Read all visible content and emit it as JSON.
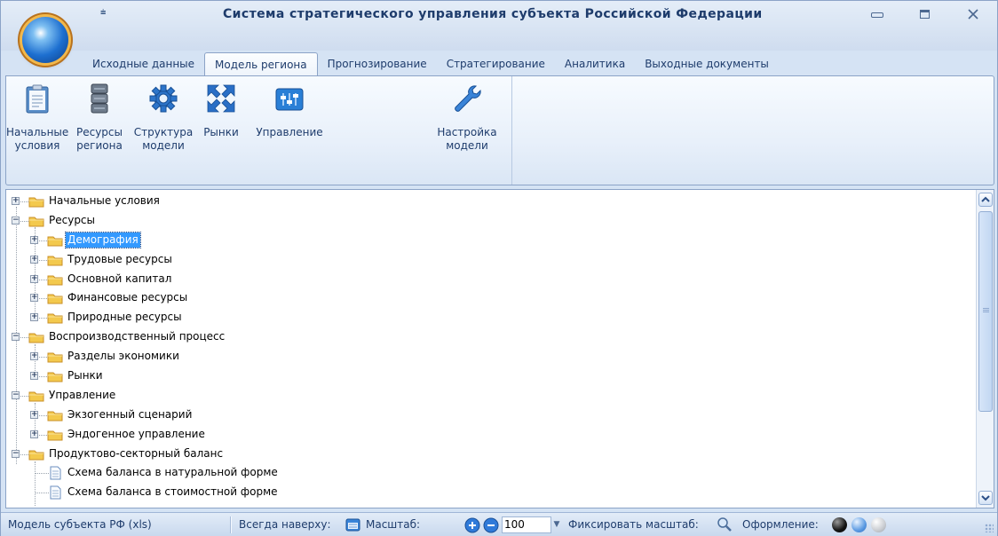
{
  "window": {
    "title": "Система стратегического управления субъекта Российской Федерации",
    "qat_glyph": "⩧"
  },
  "tabs": [
    {
      "label": "Исходные данные",
      "active": false
    },
    {
      "label": "Модель региона",
      "active": true
    },
    {
      "label": "Прогнозирование",
      "active": false
    },
    {
      "label": "Стратегирование",
      "active": false
    },
    {
      "label": "Аналитика",
      "active": false
    },
    {
      "label": "Выходные документы",
      "active": false
    }
  ],
  "ribbon": {
    "buttons": [
      {
        "line1": "Начальные",
        "line2": "условия",
        "icon": "clipboard-icon"
      },
      {
        "line1": "Ресурсы",
        "line2": "региона",
        "icon": "database-icon"
      },
      {
        "line1": "Структура",
        "line2": "модели",
        "icon": "gear-icon"
      },
      {
        "line1": "Рынки",
        "line2": "",
        "icon": "arrows-icon"
      },
      {
        "line1": "Управление",
        "line2": "",
        "icon": "control-panel-icon"
      },
      {
        "line1": "Настройка",
        "line2": "модели",
        "icon": "wrench-icon"
      }
    ]
  },
  "tree": {
    "nodes": [
      {
        "label": "Начальные условия",
        "level": 0,
        "expander": "+",
        "type": "folder"
      },
      {
        "label": "Ресурсы",
        "level": 0,
        "expander": "−",
        "type": "folder"
      },
      {
        "label": "Демография",
        "level": 1,
        "expander": "+",
        "type": "folder",
        "selected": true
      },
      {
        "label": "Трудовые ресурсы",
        "level": 1,
        "expander": "+",
        "type": "folder"
      },
      {
        "label": "Основной капитал",
        "level": 1,
        "expander": "+",
        "type": "folder"
      },
      {
        "label": "Финансовые ресурсы",
        "level": 1,
        "expander": "+",
        "type": "folder"
      },
      {
        "label": "Природные ресурсы",
        "level": 1,
        "expander": "+",
        "type": "folder"
      },
      {
        "label": "Воспроизводственный процесс",
        "level": 0,
        "expander": "−",
        "type": "folder"
      },
      {
        "label": "Разделы экономики",
        "level": 1,
        "expander": "+",
        "type": "folder"
      },
      {
        "label": "Рынки",
        "level": 1,
        "expander": "+",
        "type": "folder"
      },
      {
        "label": "Управление",
        "level": 0,
        "expander": "−",
        "type": "folder"
      },
      {
        "label": "Экзогенный сценарий",
        "level": 1,
        "expander": "+",
        "type": "folder"
      },
      {
        "label": "Эндогенное управление",
        "level": 1,
        "expander": "+",
        "type": "folder"
      },
      {
        "label": "Продуктово-секторный баланс",
        "level": 0,
        "expander": "−",
        "type": "folder"
      },
      {
        "label": "Схема баланса в натуральной форме",
        "level": 1,
        "expander": "",
        "type": "document"
      },
      {
        "label": "Схема баланса в стоимостной форме",
        "level": 1,
        "expander": "",
        "type": "document"
      }
    ]
  },
  "statusbar": {
    "model_name": "Модель субъекта РФ (xls)",
    "always_on_top_label": "Всегда наверху:",
    "scale_label": "Масштаб:",
    "scale_value": "100",
    "fix_scale_label": "Фиксировать масштаб:",
    "theme_label": "Оформление:"
  },
  "colors": {
    "selection": "#3399ff",
    "folder": "#f3c94d",
    "accent_blue": "#1d6fd0"
  }
}
